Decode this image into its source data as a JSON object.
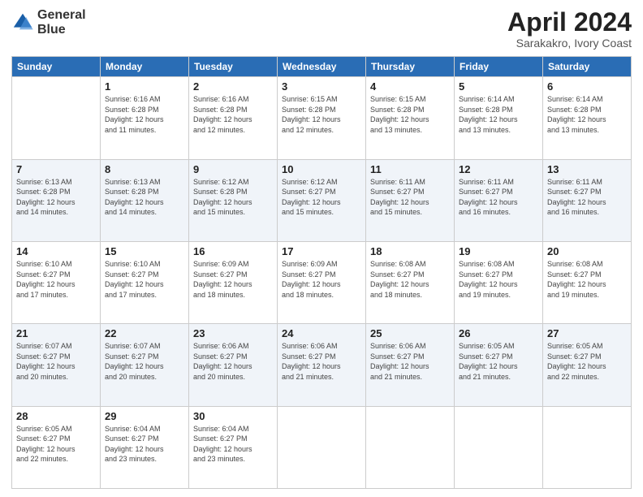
{
  "header": {
    "logo_line1": "General",
    "logo_line2": "Blue",
    "month": "April 2024",
    "location": "Sarakakro, Ivory Coast"
  },
  "days_of_week": [
    "Sunday",
    "Monday",
    "Tuesday",
    "Wednesday",
    "Thursday",
    "Friday",
    "Saturday"
  ],
  "weeks": [
    [
      {
        "day": "",
        "info": ""
      },
      {
        "day": "1",
        "info": "Sunrise: 6:16 AM\nSunset: 6:28 PM\nDaylight: 12 hours\nand 11 minutes."
      },
      {
        "day": "2",
        "info": "Sunrise: 6:16 AM\nSunset: 6:28 PM\nDaylight: 12 hours\nand 12 minutes."
      },
      {
        "day": "3",
        "info": "Sunrise: 6:15 AM\nSunset: 6:28 PM\nDaylight: 12 hours\nand 12 minutes."
      },
      {
        "day": "4",
        "info": "Sunrise: 6:15 AM\nSunset: 6:28 PM\nDaylight: 12 hours\nand 13 minutes."
      },
      {
        "day": "5",
        "info": "Sunrise: 6:14 AM\nSunset: 6:28 PM\nDaylight: 12 hours\nand 13 minutes."
      },
      {
        "day": "6",
        "info": "Sunrise: 6:14 AM\nSunset: 6:28 PM\nDaylight: 12 hours\nand 13 minutes."
      }
    ],
    [
      {
        "day": "7",
        "info": "Sunrise: 6:13 AM\nSunset: 6:28 PM\nDaylight: 12 hours\nand 14 minutes."
      },
      {
        "day": "8",
        "info": "Sunrise: 6:13 AM\nSunset: 6:28 PM\nDaylight: 12 hours\nand 14 minutes."
      },
      {
        "day": "9",
        "info": "Sunrise: 6:12 AM\nSunset: 6:28 PM\nDaylight: 12 hours\nand 15 minutes."
      },
      {
        "day": "10",
        "info": "Sunrise: 6:12 AM\nSunset: 6:27 PM\nDaylight: 12 hours\nand 15 minutes."
      },
      {
        "day": "11",
        "info": "Sunrise: 6:11 AM\nSunset: 6:27 PM\nDaylight: 12 hours\nand 15 minutes."
      },
      {
        "day": "12",
        "info": "Sunrise: 6:11 AM\nSunset: 6:27 PM\nDaylight: 12 hours\nand 16 minutes."
      },
      {
        "day": "13",
        "info": "Sunrise: 6:11 AM\nSunset: 6:27 PM\nDaylight: 12 hours\nand 16 minutes."
      }
    ],
    [
      {
        "day": "14",
        "info": "Sunrise: 6:10 AM\nSunset: 6:27 PM\nDaylight: 12 hours\nand 17 minutes."
      },
      {
        "day": "15",
        "info": "Sunrise: 6:10 AM\nSunset: 6:27 PM\nDaylight: 12 hours\nand 17 minutes."
      },
      {
        "day": "16",
        "info": "Sunrise: 6:09 AM\nSunset: 6:27 PM\nDaylight: 12 hours\nand 18 minutes."
      },
      {
        "day": "17",
        "info": "Sunrise: 6:09 AM\nSunset: 6:27 PM\nDaylight: 12 hours\nand 18 minutes."
      },
      {
        "day": "18",
        "info": "Sunrise: 6:08 AM\nSunset: 6:27 PM\nDaylight: 12 hours\nand 18 minutes."
      },
      {
        "day": "19",
        "info": "Sunrise: 6:08 AM\nSunset: 6:27 PM\nDaylight: 12 hours\nand 19 minutes."
      },
      {
        "day": "20",
        "info": "Sunrise: 6:08 AM\nSunset: 6:27 PM\nDaylight: 12 hours\nand 19 minutes."
      }
    ],
    [
      {
        "day": "21",
        "info": "Sunrise: 6:07 AM\nSunset: 6:27 PM\nDaylight: 12 hours\nand 20 minutes."
      },
      {
        "day": "22",
        "info": "Sunrise: 6:07 AM\nSunset: 6:27 PM\nDaylight: 12 hours\nand 20 minutes."
      },
      {
        "day": "23",
        "info": "Sunrise: 6:06 AM\nSunset: 6:27 PM\nDaylight: 12 hours\nand 20 minutes."
      },
      {
        "day": "24",
        "info": "Sunrise: 6:06 AM\nSunset: 6:27 PM\nDaylight: 12 hours\nand 21 minutes."
      },
      {
        "day": "25",
        "info": "Sunrise: 6:06 AM\nSunset: 6:27 PM\nDaylight: 12 hours\nand 21 minutes."
      },
      {
        "day": "26",
        "info": "Sunrise: 6:05 AM\nSunset: 6:27 PM\nDaylight: 12 hours\nand 21 minutes."
      },
      {
        "day": "27",
        "info": "Sunrise: 6:05 AM\nSunset: 6:27 PM\nDaylight: 12 hours\nand 22 minutes."
      }
    ],
    [
      {
        "day": "28",
        "info": "Sunrise: 6:05 AM\nSunset: 6:27 PM\nDaylight: 12 hours\nand 22 minutes."
      },
      {
        "day": "29",
        "info": "Sunrise: 6:04 AM\nSunset: 6:27 PM\nDaylight: 12 hours\nand 23 minutes."
      },
      {
        "day": "30",
        "info": "Sunrise: 6:04 AM\nSunset: 6:27 PM\nDaylight: 12 hours\nand 23 minutes."
      },
      {
        "day": "",
        "info": ""
      },
      {
        "day": "",
        "info": ""
      },
      {
        "day": "",
        "info": ""
      },
      {
        "day": "",
        "info": ""
      }
    ]
  ]
}
